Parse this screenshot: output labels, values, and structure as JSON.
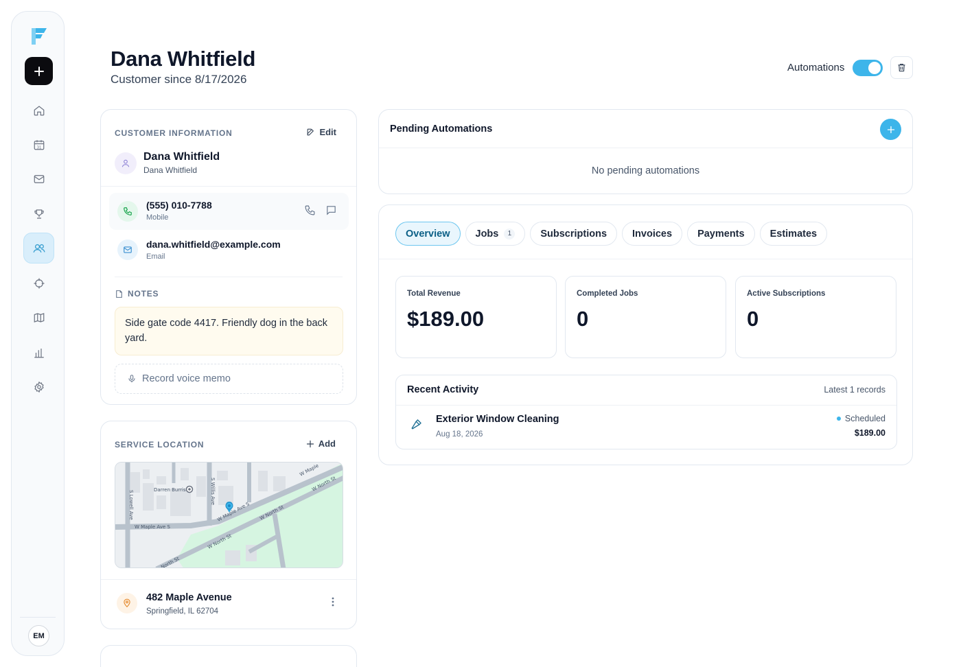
{
  "sidebar": {
    "new_button_symbol": "+",
    "items": [
      {
        "name": "home",
        "icon": "home-icon",
        "active": false
      },
      {
        "name": "calendar",
        "icon": "calendar-icon",
        "active": false
      },
      {
        "name": "mail",
        "icon": "mail-icon",
        "active": false
      },
      {
        "name": "trophy",
        "icon": "trophy-icon",
        "active": false
      },
      {
        "name": "customers",
        "icon": "users-icon",
        "active": true
      },
      {
        "name": "target",
        "icon": "crosshair-icon",
        "active": false
      },
      {
        "name": "map",
        "icon": "map-icon",
        "active": false
      },
      {
        "name": "reports",
        "icon": "bar-chart-icon",
        "active": false
      },
      {
        "name": "settings",
        "icon": "gear-icon",
        "active": false
      }
    ],
    "user_initials": "EM"
  },
  "header": {
    "title": "Dana Whitfield",
    "subtitle": "Customer since 8/17/2026",
    "automations_label": "Automations",
    "automations_on": true
  },
  "customer_info": {
    "section_label": "CUSTOMER INFORMATION",
    "edit_label": "Edit",
    "name": "Dana Whitfield",
    "name_sub": "Dana Whitfield",
    "phone": "(555) 010-7788",
    "phone_type": "Mobile",
    "email": "dana.whitfield@example.com",
    "email_type": "Email",
    "notes_label": "NOTES",
    "notes_text": "Side gate code 4417. Friendly dog in the back yard.",
    "memo_label": "Record voice memo"
  },
  "service_location": {
    "section_label": "SERVICE LOCATION",
    "add_label": "Add",
    "map_labels": {
      "poi": "Darren Burris",
      "s_lowell": "S Lowell Ave",
      "s_willis": "S Willis Ave",
      "maple_s_left": "W Maple Ave S",
      "maple_s_right": "W Maple Ave S",
      "north_1": "W North St",
      "north_2": "W North St",
      "north_3": "W North St",
      "maple_top": "W Maple",
      "north_bottom": "North St"
    },
    "address_line1": "482 Maple Avenue",
    "address_line2": "Springfield, IL 62704"
  },
  "pending_automations": {
    "title": "Pending Automations",
    "empty_text": "No pending automations"
  },
  "tabs": [
    {
      "label": "Overview",
      "active": true,
      "count": null
    },
    {
      "label": "Jobs",
      "active": false,
      "count": "1"
    },
    {
      "label": "Subscriptions",
      "active": false,
      "count": null
    },
    {
      "label": "Invoices",
      "active": false,
      "count": null
    },
    {
      "label": "Payments",
      "active": false,
      "count": null
    },
    {
      "label": "Estimates",
      "active": false,
      "count": null
    }
  ],
  "stats": [
    {
      "label": "Total Revenue",
      "value": "$189.00"
    },
    {
      "label": "Completed Jobs",
      "value": "0"
    },
    {
      "label": "Active Subscriptions",
      "value": "0"
    }
  ],
  "recent_activity": {
    "title": "Recent Activity",
    "meta": "Latest 1 records",
    "items": [
      {
        "name": "Exterior Window Cleaning",
        "date": "Aug 18, 2026",
        "status": "Scheduled",
        "amount": "$189.00",
        "icon": "hammer-icon"
      }
    ]
  },
  "colors": {
    "accent": "#3db5ea",
    "active_nav_bg": "#d9eefb",
    "notes_bg": "#fffbef",
    "map_park": "#d6f5e1"
  }
}
